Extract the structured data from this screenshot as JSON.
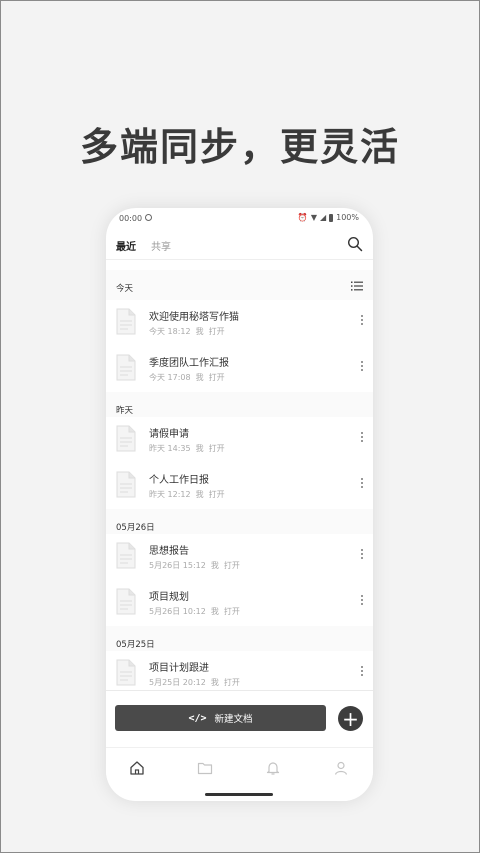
{
  "headline": "多端同步，更灵活",
  "status_bar": {
    "time": "00:00",
    "battery": "100%"
  },
  "header": {
    "tabs": [
      {
        "label": "最近"
      },
      {
        "label": "共享"
      }
    ]
  },
  "sections": [
    {
      "title": "今天"
    },
    {
      "title": "昨天"
    },
    {
      "title": "05月26日"
    },
    {
      "title": "05月25日"
    }
  ],
  "docs": [
    {
      "title": "欢迎使用秘塔写作猫",
      "time": "今天 18:12",
      "by": "我",
      "action": "打开"
    },
    {
      "title": "季度团队工作汇报",
      "time": "今天 17:08",
      "by": "我",
      "action": "打开"
    },
    {
      "title": "请假申请",
      "time": "昨天 14:35",
      "by": "我",
      "action": "打开"
    },
    {
      "title": "个人工作日报",
      "time": "昨天 12:12",
      "by": "我",
      "action": "打开"
    },
    {
      "title": "思想报告",
      "time": "5月26日 15:12",
      "by": "我",
      "action": "打开"
    },
    {
      "title": "项目规划",
      "time": "5月26日 10:12",
      "by": "我",
      "action": "打开"
    },
    {
      "title": "项目计划跟进",
      "time": "5月25日 20:12",
      "by": "我",
      "action": "打开"
    }
  ],
  "new_doc_button": {
    "code": "</>",
    "label": "新建文档"
  },
  "icons": {
    "search": "search-icon",
    "list_view": "list-view-icon",
    "doc": "document-icon",
    "more": "more-vertical-icon",
    "add": "plus-icon",
    "home": "home-icon",
    "folder": "folder-icon",
    "bell": "bell-icon",
    "user": "user-icon"
  }
}
